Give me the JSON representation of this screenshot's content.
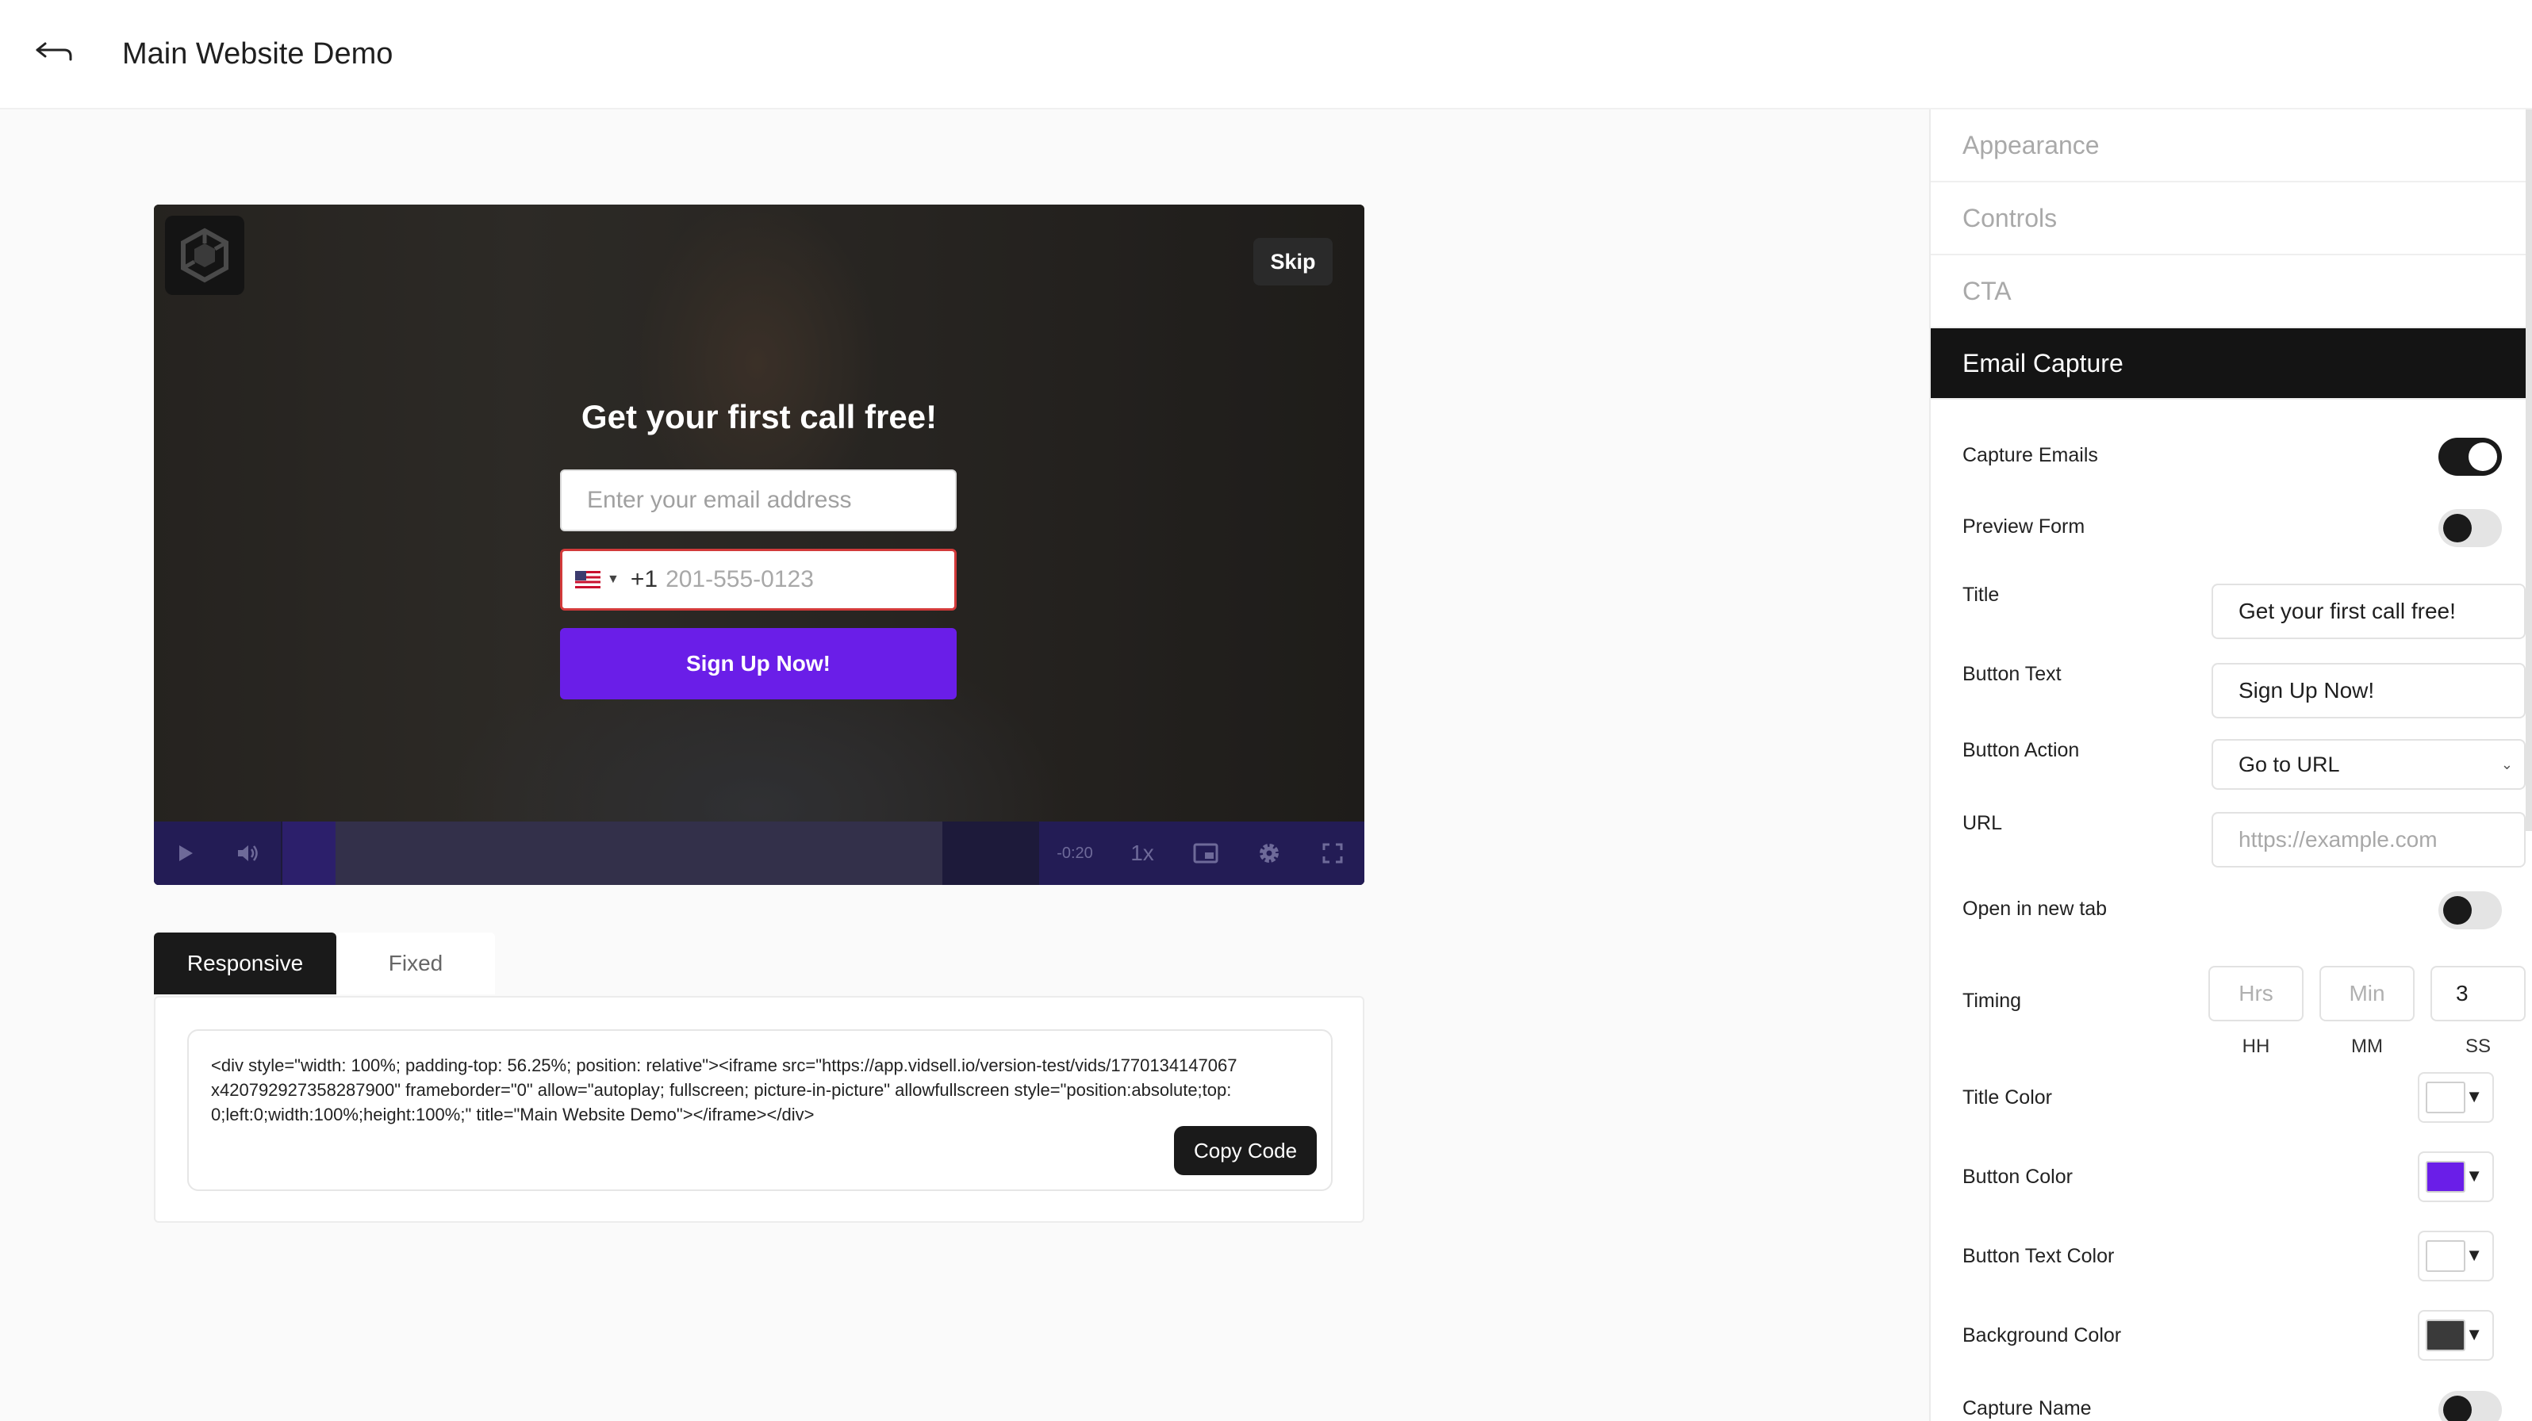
{
  "header": {
    "title": "Main Website Demo",
    "back_icon": "back-arrow-icon"
  },
  "video": {
    "logo_icon": "cube-logo-icon",
    "skip_label": "Skip",
    "form": {
      "title": "Get your first call free!",
      "email_placeholder": "Enter your email address",
      "dial_code": "+1",
      "phone_placeholder": "201-555-0123",
      "button_label": "Sign Up Now!"
    },
    "controls": {
      "time": "-0:20",
      "speed": "1x",
      "progress": 0.08
    }
  },
  "embed": {
    "tabs": [
      {
        "label": "Responsive",
        "active": true
      },
      {
        "label": "Fixed",
        "active": false
      }
    ],
    "code": "<div style=\"width: 100%; padding-top: 56.25%; position: relative\"><iframe src=\"https://app.vidsell.io/version-test/vids/1770134147067x420792927358287900\" frameborder=\"0\" allow=\"autoplay; fullscreen; picture-in-picture\" allowfullscreen style=\"position:absolute;top:0;left:0;width:100%;height:100%;\" title=\"Main Website Demo\"></iframe></div>",
    "copy_label": "Copy Code"
  },
  "sidebar": {
    "tabs": [
      {
        "label": "Appearance",
        "active": false
      },
      {
        "label": "Controls",
        "active": false
      },
      {
        "label": "CTA",
        "active": false
      },
      {
        "label": "Email Capture",
        "active": true
      }
    ],
    "capture_emails": {
      "label": "Capture Emails",
      "on": true
    },
    "preview_form": {
      "label": "Preview Form",
      "on": false
    },
    "title": {
      "label": "Title",
      "value": "Get your first call free!"
    },
    "button_text": {
      "label": "Button Text",
      "value": "Sign Up Now!"
    },
    "button_action": {
      "label": "Button Action",
      "value": "Go to URL"
    },
    "url": {
      "label": "URL",
      "placeholder": "https://example.com"
    },
    "open_new_tab": {
      "label": "Open in new tab",
      "on": false
    },
    "timing": {
      "label": "Timing",
      "hrs_placeholder": "Hrs",
      "min_placeholder": "Min",
      "ss_value": "3",
      "units": [
        "HH",
        "MM",
        "SS"
      ]
    },
    "title_color": {
      "label": "Title Color",
      "color": "#ffffff"
    },
    "button_color": {
      "label": "Button Color",
      "color": "#6a1ee8"
    },
    "button_text_color": {
      "label": "Button Text Color",
      "color": "#ffffff"
    },
    "background_color": {
      "label": "Background Color",
      "color": "#3a3a3a"
    },
    "capture_name": {
      "label": "Capture Name",
      "on": false
    }
  }
}
